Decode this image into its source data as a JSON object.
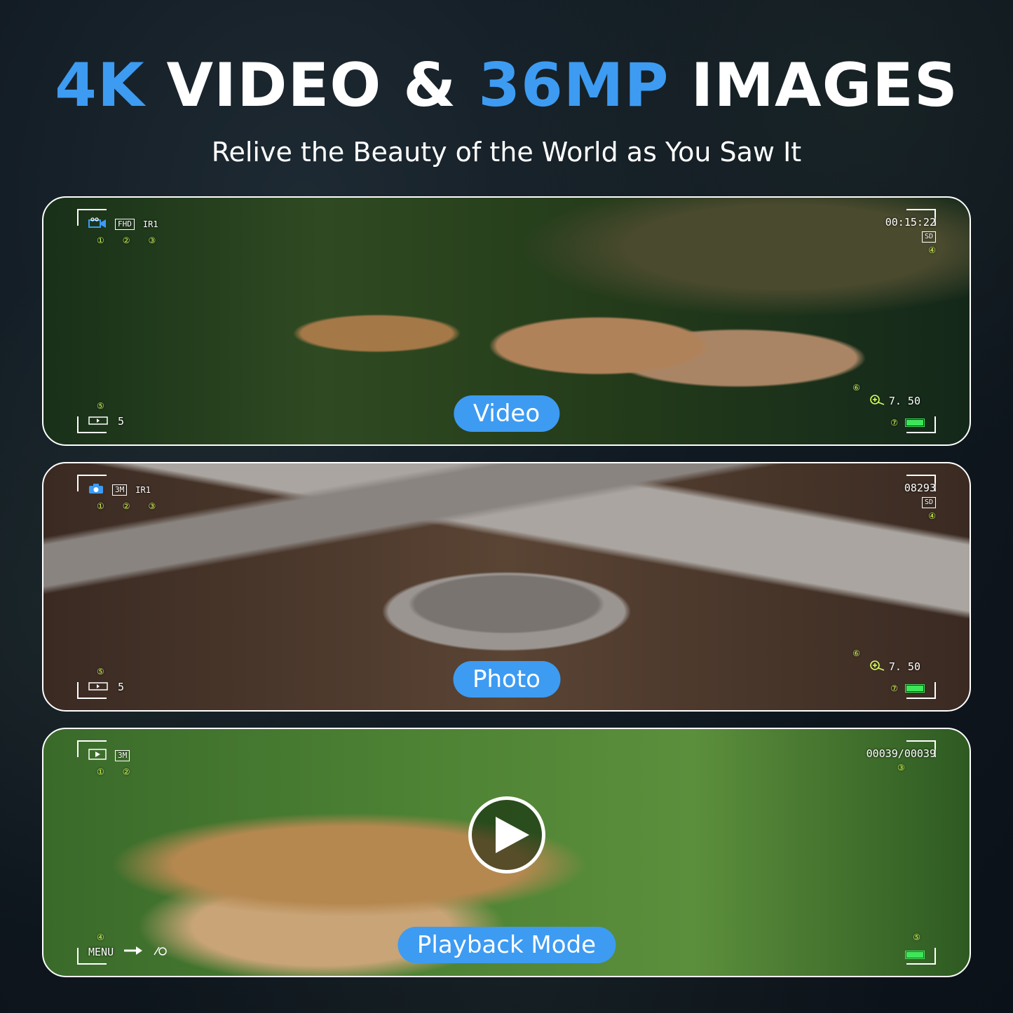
{
  "headline": {
    "part1": "4K",
    "part2": " VIDEO & ",
    "part3": "36MP",
    "part4": " IMAGES"
  },
  "subtitle": "Relive the Beauty of the World as You Saw It",
  "colors": {
    "accent": "#3d9bf2",
    "text": "#ffffff",
    "hud_numbers": "#d7ff5a",
    "battery": "#3ee65a"
  },
  "panels": {
    "video": {
      "label": "Video",
      "hud": {
        "resolution": "FHD",
        "ir": "IR1",
        "nums": [
          "①",
          "②",
          "③"
        ],
        "time": "00:15:22",
        "storage": "SD",
        "num_4": "④",
        "num_5": "⑤",
        "shots": "5",
        "num_6": "⑥",
        "zoom": "7. 50",
        "num_7": "⑦"
      }
    },
    "photo": {
      "label": "Photo",
      "hud": {
        "resolution": "3M",
        "ir": "IR1",
        "nums": [
          "①",
          "②",
          "③"
        ],
        "count": "08293",
        "storage": "SD",
        "num_4": "④",
        "num_5": "⑤",
        "shots": "5",
        "num_6": "⑥",
        "zoom": "7. 50",
        "num_7": "⑦"
      }
    },
    "playback": {
      "label": "Playback Mode",
      "hud": {
        "resolution": "3M",
        "nums": [
          "①",
          "②"
        ],
        "file_count": "00039/00039",
        "num_3": "③",
        "num_4": "④",
        "menu": "MENU",
        "num_5": "⑤"
      }
    }
  }
}
